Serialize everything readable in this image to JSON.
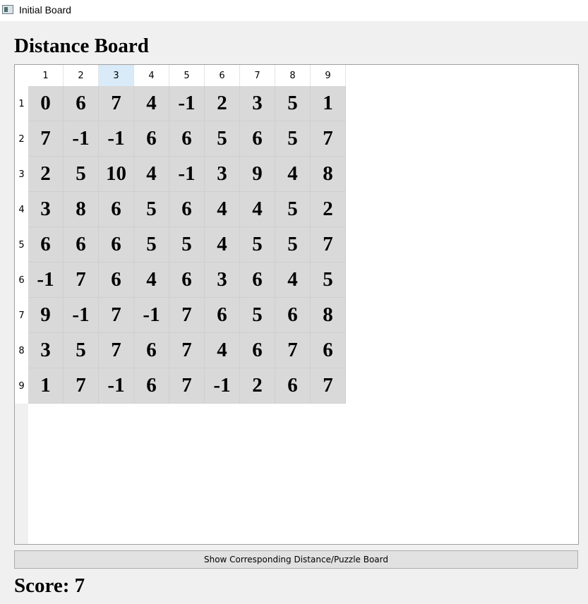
{
  "window": {
    "title": "Initial Board",
    "icon": "app-window-icon"
  },
  "heading": "Distance Board",
  "table": {
    "column_headers": [
      "1",
      "2",
      "3",
      "4",
      "5",
      "6",
      "7",
      "8",
      "9"
    ],
    "row_headers": [
      "1",
      "2",
      "3",
      "4",
      "5",
      "6",
      "7",
      "8",
      "9"
    ],
    "selected_column": 3,
    "rows": [
      [
        "0",
        "6",
        "7",
        "4",
        "-1",
        "2",
        "3",
        "5",
        "1"
      ],
      [
        "7",
        "-1",
        "-1",
        "6",
        "6",
        "5",
        "6",
        "5",
        "7"
      ],
      [
        "2",
        "5",
        "10",
        "4",
        "-1",
        "3",
        "9",
        "4",
        "8"
      ],
      [
        "3",
        "8",
        "6",
        "5",
        "6",
        "4",
        "4",
        "5",
        "2"
      ],
      [
        "6",
        "6",
        "6",
        "5",
        "5",
        "4",
        "5",
        "5",
        "7"
      ],
      [
        "-1",
        "7",
        "6",
        "4",
        "6",
        "3",
        "6",
        "4",
        "5"
      ],
      [
        "9",
        "-1",
        "7",
        "-1",
        "7",
        "6",
        "5",
        "6",
        "8"
      ],
      [
        "3",
        "5",
        "7",
        "6",
        "7",
        "4",
        "6",
        "7",
        "6"
      ],
      [
        "1",
        "7",
        "-1",
        "6",
        "7",
        "-1",
        "2",
        "6",
        "7"
      ]
    ]
  },
  "button": {
    "label": "Show Corresponding Distance/Puzzle Board"
  },
  "score": {
    "text": "Score: 7"
  },
  "colors": {
    "window_bg": "#f0f0f0",
    "cell_bg": "#d9d9d9",
    "selected_header": "#d9ebf9"
  }
}
